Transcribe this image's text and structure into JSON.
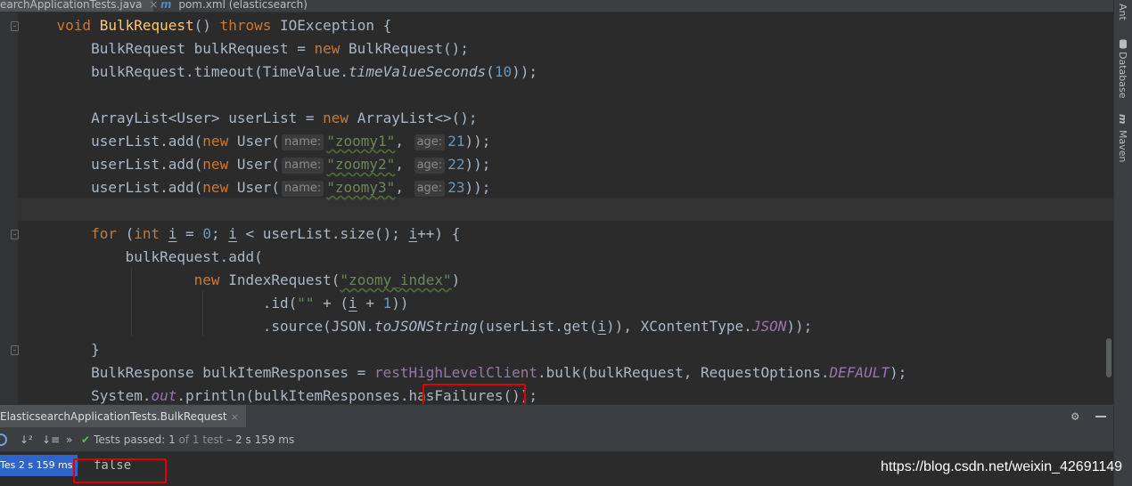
{
  "tabs": {
    "active": "earchApplicationTests.java",
    "close_glyph": "×",
    "second_icon": "m",
    "second": "pom.xml (elasticsearch)"
  },
  "code": {
    "l1": {
      "kw1": "void ",
      "name": "BulkRequest",
      "p": "() ",
      "kw2": "throws ",
      "rest": "IOException {"
    },
    "l2": {
      "a": "BulkRequest bulkRequest = ",
      "kw": "new ",
      "b": "BulkRequest();"
    },
    "l3": {
      "a": "bulkRequest.timeout(TimeValue.",
      "it": "timeValueSeconds",
      "b": "(",
      "num": "10",
      "c": "));"
    },
    "l5": {
      "a": "ArrayList<User> userList = ",
      "kw": "new ",
      "b": "ArrayList<>();"
    },
    "users": [
      {
        "a": "userList.add(",
        "kw": "new ",
        "b": "User(",
        "hint1": "name:",
        "str": "\"zoomy1\"",
        "sep": ", ",
        "hint2": "age:",
        "num": "21",
        "c": "));"
      },
      {
        "a": "userList.add(",
        "kw": "new ",
        "b": "User(",
        "hint1": "name:",
        "str": "\"zoomy2\"",
        "sep": ", ",
        "hint2": "age:",
        "num": "22",
        "c": "));"
      },
      {
        "a": "userList.add(",
        "kw": "new ",
        "b": "User(",
        "hint1": "name:",
        "str": "\"zoomy3\"",
        "sep": ", ",
        "hint2": "age:",
        "num": "23",
        "c": "));"
      }
    ],
    "l10": {
      "kw1": "for ",
      "p1": "(",
      "kw2": "int ",
      "v1": "i",
      "p2": " = ",
      "n0": "0",
      "p3": "; ",
      "v2": "i",
      "p4": " < userList.size(); ",
      "v3": "i",
      "p5": "++) {"
    },
    "l11": "bulkRequest.add(",
    "l12": {
      "kw": "new ",
      "a": "IndexRequest(",
      "str": "\"zoomy_index\"",
      "b": ")"
    },
    "l13": {
      "a": ".id(",
      "str": "\"\"",
      "b": " + (",
      "v": "i",
      "c": " + ",
      "num": "1",
      "d": "))"
    },
    "l14": {
      "a": ".source(JSON.",
      "it": "toJSONString",
      "b": "(userList.get(",
      "v": "i",
      "c": ")), XContentType.",
      "st": "JSON",
      "d": "));"
    },
    "l15": "}",
    "l16": {
      "a": "BulkResponse bulkItemResponses = ",
      "fld": "restHighLevelClient",
      "b": ".bulk(bulkRequest, RequestOptions.",
      "st": "DEFAULT",
      "c": ");"
    },
    "l17": {
      "a": "System.",
      "st": "out",
      "b": ".println(bulkItemResponses.",
      "hl": "hasFailures",
      "c": "());"
    }
  },
  "run": {
    "tab_label": "ElasticsearchApplicationTests.BulkRequest",
    "close_glyph": "×",
    "settings_glyph": "⚙",
    "sort_alpha_glyph": "↓²",
    "sort_duration_glyph": "↓≡",
    "expand_glyph": "»",
    "check_glyph": "✔",
    "status_prefix": "Tests passed: ",
    "passed": "1",
    "status_of": " of 1 test",
    "status_time": " – 2 s 159 ms",
    "tree_item": "Tes 2 s 159 ms",
    "output": "false"
  },
  "tool_windows": {
    "ant": "Ant",
    "database": "Database",
    "maven_icon": "m",
    "maven": "Maven"
  },
  "watermark": "https://blog.csdn.net/weixin_42691149",
  "colors": {
    "keyword": "#cc7832",
    "method": "#ffc66d",
    "string": "#6a8759",
    "number": "#6897bb",
    "static": "#9876aa",
    "highlight_box": "#e00000",
    "test_pass": "#5fb85f",
    "selection": "#2f65ca"
  }
}
